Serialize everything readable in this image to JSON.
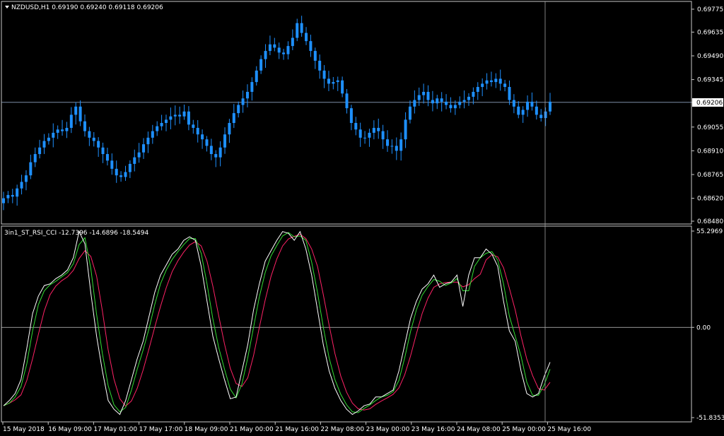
{
  "colors": {
    "background": "#000000",
    "frame": "#c8c8c8",
    "candle": "#1e90ff",
    "price_line": "#8ea3c0",
    "stoch_main": "#ffffff",
    "stoch_green": "#33dd33",
    "stoch_signal": "#ff2266"
  },
  "main_panel": {
    "header": "NZDUSD,H1  0.69190 0.69240 0.69118 0.69206",
    "menu_icon": "triangle-down-icon",
    "current_price_label": "0.69206",
    "y_tick_labels": [
      "0.69775",
      "0.69635",
      "0.69490",
      "0.69345",
      "0.69206",
      "0.69055",
      "0.68910",
      "0.68765",
      "0.68620",
      "0.68480"
    ]
  },
  "indicator_panel": {
    "header": "3in1_ST_RSI_CCI -12.7396 -14.6896 -18.5494",
    "y_tick_labels": [
      "55.2969",
      "0.00",
      "-51.8353"
    ]
  },
  "x_axis": {
    "labels": [
      "15 May 2018",
      "16 May 09:00",
      "17 May 01:00",
      "17 May 17:00",
      "18 May 09:00",
      "21 May 00:00",
      "21 May 16:00",
      "22 May 08:00",
      "23 May 00:00",
      "23 May 16:00",
      "24 May 08:00",
      "25 May 00:00",
      "25 May 16:00"
    ]
  },
  "chart_data": [
    {
      "type": "candlestick",
      "symbol": "NZDUSD",
      "timeframe": "H1",
      "ohlc_last": {
        "open": 0.6919,
        "high": 0.6924,
        "low": 0.69118,
        "close": 0.69206
      },
      "ylim": [
        0.6848,
        0.69775
      ],
      "x_labels": [
        "15 May 2018",
        "16 May 09:00",
        "17 May 01:00",
        "17 May 17:00",
        "18 May 09:00",
        "21 May 00:00",
        "21 May 16:00",
        "22 May 08:00",
        "23 May 00:00",
        "23 May 16:00",
        "24 May 08:00",
        "25 May 00:00",
        "25 May 16:00"
      ],
      "close_series_approx": [
        0.6862,
        0.6864,
        0.6863,
        0.6868,
        0.6872,
        0.6876,
        0.6884,
        0.6889,
        0.6893,
        0.6897,
        0.6899,
        0.6902,
        0.6904,
        0.6903,
        0.6905,
        0.6913,
        0.6918,
        0.6909,
        0.6903,
        0.6899,
        0.6897,
        0.6893,
        0.6889,
        0.6885,
        0.688,
        0.6876,
        0.6875,
        0.6878,
        0.6883,
        0.6887,
        0.689,
        0.6895,
        0.6899,
        0.6903,
        0.6906,
        0.6908,
        0.691,
        0.6912,
        0.6913,
        0.6912,
        0.6915,
        0.6907,
        0.6905,
        0.6901,
        0.6898,
        0.6894,
        0.6889,
        0.6887,
        0.6893,
        0.6901,
        0.6908,
        0.6914,
        0.6919,
        0.6923,
        0.6927,
        0.6933,
        0.694,
        0.6947,
        0.6952,
        0.6956,
        0.6954,
        0.6951,
        0.695,
        0.6955,
        0.696,
        0.6969,
        0.6963,
        0.6958,
        0.6952,
        0.6946,
        0.694,
        0.6935,
        0.6932,
        0.6933,
        0.6934,
        0.6926,
        0.6917,
        0.6908,
        0.6904,
        0.6899,
        0.6899,
        0.6902,
        0.6905,
        0.6903,
        0.6898,
        0.6894,
        0.6894,
        0.6891,
        0.6898,
        0.691,
        0.6918,
        0.6922,
        0.6925,
        0.6927,
        0.6922,
        0.692,
        0.6923,
        0.6921,
        0.6919,
        0.6917,
        0.6919,
        0.6921,
        0.6922,
        0.6924,
        0.6927,
        0.693,
        0.6932,
        0.6934,
        0.6933,
        0.6935,
        0.6932,
        0.693,
        0.6922,
        0.6918,
        0.6913,
        0.6916,
        0.6921,
        0.6918,
        0.6913,
        0.6911,
        0.6915,
        0.6921
      ]
    },
    {
      "type": "line",
      "name": "3in1_ST_RSI_CCI",
      "ylim": [
        -51.8353,
        55.2969
      ],
      "last_values": [
        -12.7396,
        -14.6896,
        -18.5494
      ],
      "zero_line": 0,
      "main_series_approx": [
        -45,
        -42,
        -38,
        -30,
        -12,
        8,
        18,
        24,
        25,
        28,
        30,
        33,
        40,
        55,
        48,
        20,
        -5,
        -25,
        -42,
        -47,
        -50,
        -42,
        -30,
        -18,
        -8,
        6,
        20,
        30,
        36,
        42,
        45,
        50,
        52,
        50,
        35,
        15,
        -5,
        -18,
        -30,
        -41,
        -40,
        -25,
        -10,
        10,
        25,
        38,
        44,
        50,
        55,
        54,
        50,
        55,
        45,
        30,
        10,
        -10,
        -25,
        -35,
        -42,
        -47,
        -50,
        -48,
        -45,
        -44,
        -40,
        -40,
        -38,
        -36,
        -25,
        -10,
        5,
        15,
        22,
        25,
        30,
        23,
        25,
        26,
        30,
        12,
        30,
        40,
        40,
        45,
        42,
        35,
        15,
        -2,
        -8,
        -25,
        -38,
        -40,
        -38,
        -28,
        -20
      ]
    }
  ]
}
